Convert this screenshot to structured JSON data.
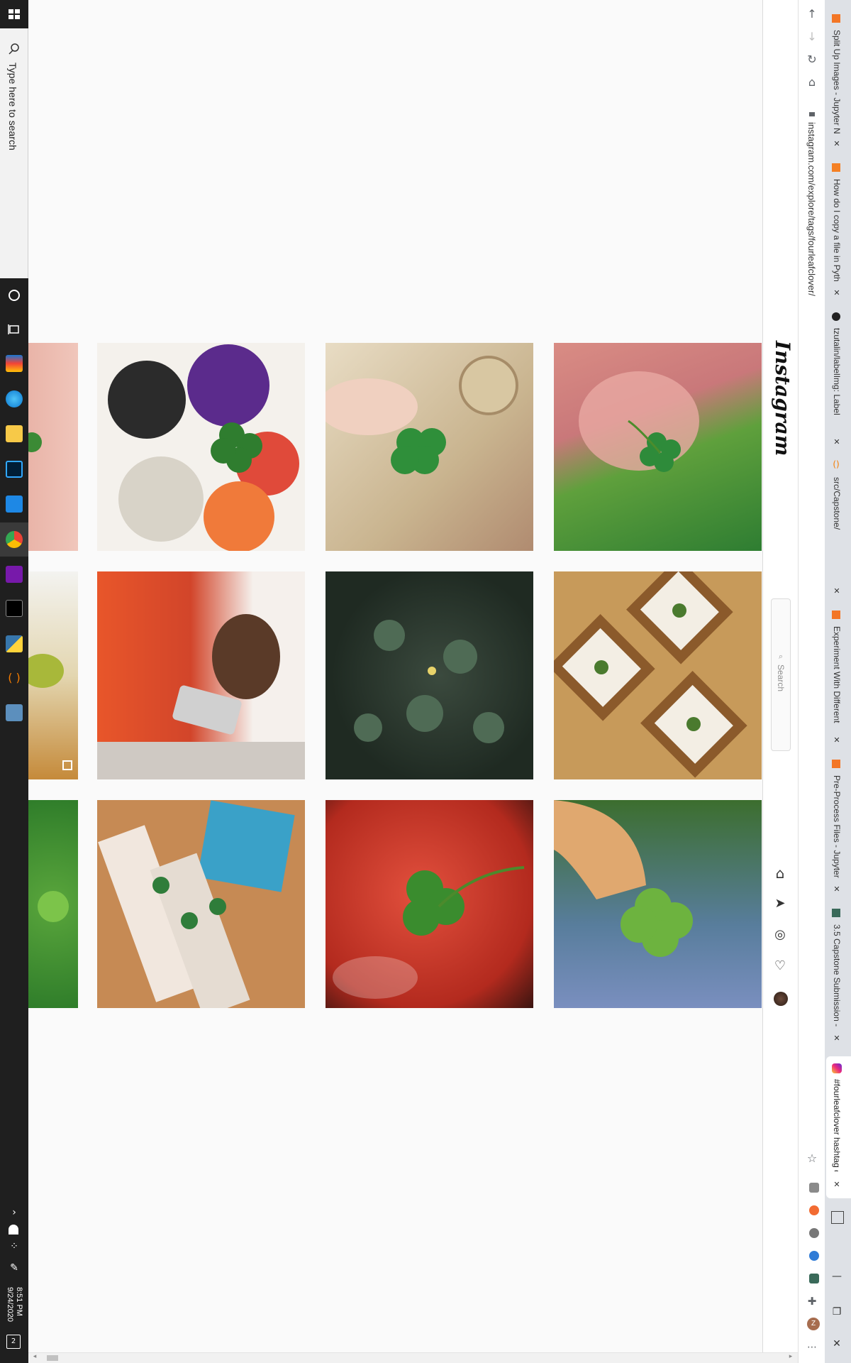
{
  "taskbar": {
    "search_placeholder": "Type here to search",
    "time": "8:51 PM",
    "date": "9/24/2020",
    "notification_count": "2"
  },
  "browser": {
    "url": "instagram.com/explore/tags/fourleafclover/",
    "tabs": [
      {
        "title": "Split Up Images - Jupyter N"
      },
      {
        "title": "How do I copy a file in Pyth"
      },
      {
        "title": "tzutalin/labelImg: Label"
      },
      {
        "title": "src/Capstone/"
      },
      {
        "title": "Experiment With Different"
      },
      {
        "title": "Pre-Process Files - Jupyter"
      },
      {
        "title": "3.5 Capstone Submission -"
      },
      {
        "title": "#fourleafclover hashtag o"
      }
    ],
    "window_controls": {
      "minimize": "—",
      "restore": "❐",
      "close": "✕"
    }
  },
  "instagram": {
    "logo": "Instagram",
    "search_placeholder": "Search"
  },
  "colors": {
    "taskbar": "#1f1f1f",
    "tab_strip": "#dee1e6",
    "page_bg": "#fafafa",
    "accent_instagram": "#e1306c"
  },
  "grid": {
    "tiles": [
      {
        "description": "clover held in hand"
      },
      {
        "description": "clover on cartoon badges"
      },
      {
        "description": "clover over ornate artwork"
      },
      {
        "description": "clover held over grass"
      },
      {
        "description": "leaf on white background"
      },
      {
        "description": "person in orange with phone"
      },
      {
        "description": "clover plants in dark foliage"
      },
      {
        "description": "pressed clovers in gold frames"
      },
      {
        "description": "clover on green grass"
      },
      {
        "description": "clover bookmarks on wooden table"
      },
      {
        "description": "clover on red tomato"
      },
      {
        "description": "clover held over blue flowers"
      }
    ]
  }
}
